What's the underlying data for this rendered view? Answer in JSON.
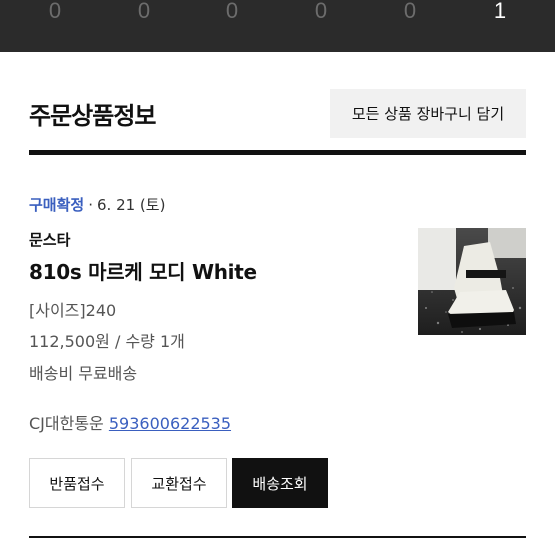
{
  "progress_steps": [
    "0",
    "0",
    "0",
    "0",
    "0",
    "1"
  ],
  "section": {
    "title": "주문상품정보",
    "add_to_cart_label": "모든 상품 장바구니 담기"
  },
  "order_item": {
    "status": "구매확정",
    "separator": "·",
    "date": "6. 21 (토)",
    "brand": "문스타",
    "product_name": "810s 마르케 모디 White",
    "option": "[사이즈]240",
    "price_qty": "112,500원 / 수량 1개",
    "shipping_fee": "배송비 무료배송",
    "carrier": "CJ대한통운",
    "tracking_number": "593600622535",
    "thumbnail_icon": "product-photo-icon"
  },
  "actions": {
    "return_label": "반품접수",
    "exchange_label": "교환접수",
    "tracking_label": "배송조회"
  },
  "colors": {
    "topbar": "#2b2b2b",
    "accent_link": "#3a5fbf",
    "primary_button": "#111111"
  }
}
